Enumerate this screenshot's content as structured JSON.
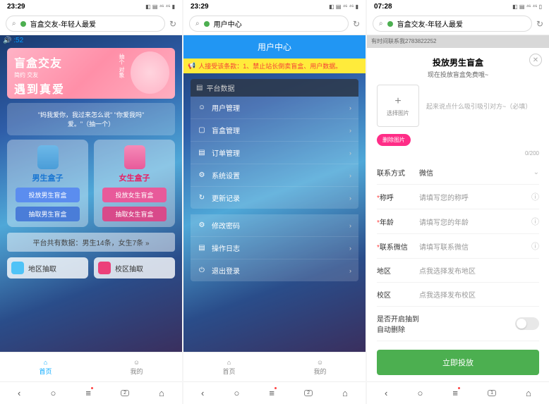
{
  "screen1": {
    "time": "23:29",
    "url": "盲盒交友-年轻人最爱",
    "sound": "🔊 :52",
    "banner": {
      "line1": "盲盒交友",
      "small": "简约\n交友",
      "line2": "遇到真爱",
      "tag": "抽个\n对象"
    },
    "msg": "\"妈我爱你，我过来怎么说\" \"你爱我吗\"\n爱。\"（抽一个）",
    "male": {
      "title": "男生盒子",
      "btn1": "投放男生盲盒",
      "btn2": "抽取男生盲盒"
    },
    "female": {
      "title": "女生盒子",
      "btn1": "投放女生盲盒",
      "btn2": "抽取女生盲盒"
    },
    "stats": "平台共有数据：男生14条，女生7条 »",
    "ba1": "地区抽取",
    "ba2": "校区抽取",
    "nav": {
      "home": "首页",
      "mine": "我的"
    }
  },
  "screen2": {
    "time": "23:29",
    "url": "用户中心",
    "header": "用户中心",
    "notice": "人接受该条款：1、禁止站长倒卖盲盒、用户数据。",
    "panel1": {
      "title": "平台数据",
      "items": [
        "用户管理",
        "盲盒管理",
        "订单管理",
        "系统设置",
        "更新记录"
      ]
    },
    "panel2": {
      "items": [
        "修改密码",
        "操作日志",
        "退出登录"
      ]
    },
    "nav": {
      "home": "首页",
      "mine": "我的"
    }
  },
  "screen3": {
    "time": "07:28",
    "url": "盲盒交友-年轻人最爱",
    "gray": "有时间联系我2783822252",
    "modal": {
      "title": "投放男生盲盒",
      "sub": "现在投放盲盒免费哦~",
      "uploadBtn": "选择图片",
      "uploadHint": "起来说点什么吸引吸引对方~（必填）",
      "delPic": "删除图片",
      "count": "0/200",
      "rows": [
        {
          "label": "联系方式",
          "value": "微信",
          "dark": true,
          "required": false,
          "chev": true
        },
        {
          "label": "称呼",
          "value": "请填写您的称呼",
          "required": true,
          "help": true
        },
        {
          "label": "年龄",
          "value": "请填写您的年龄",
          "required": true,
          "help": true
        },
        {
          "label": "联系微信",
          "value": "请填写联系微信",
          "required": true,
          "help": true
        },
        {
          "label": "地区",
          "value": "点我选择发布地区",
          "required": false
        },
        {
          "label": "校区",
          "value": "点我选择发布校区",
          "required": false
        },
        {
          "label": "是否开启抽到自动删除",
          "toggle": true,
          "required": false
        }
      ],
      "submit": "立即投放"
    }
  },
  "sysnav": {
    "badge1": "2",
    "badge3": "1"
  }
}
